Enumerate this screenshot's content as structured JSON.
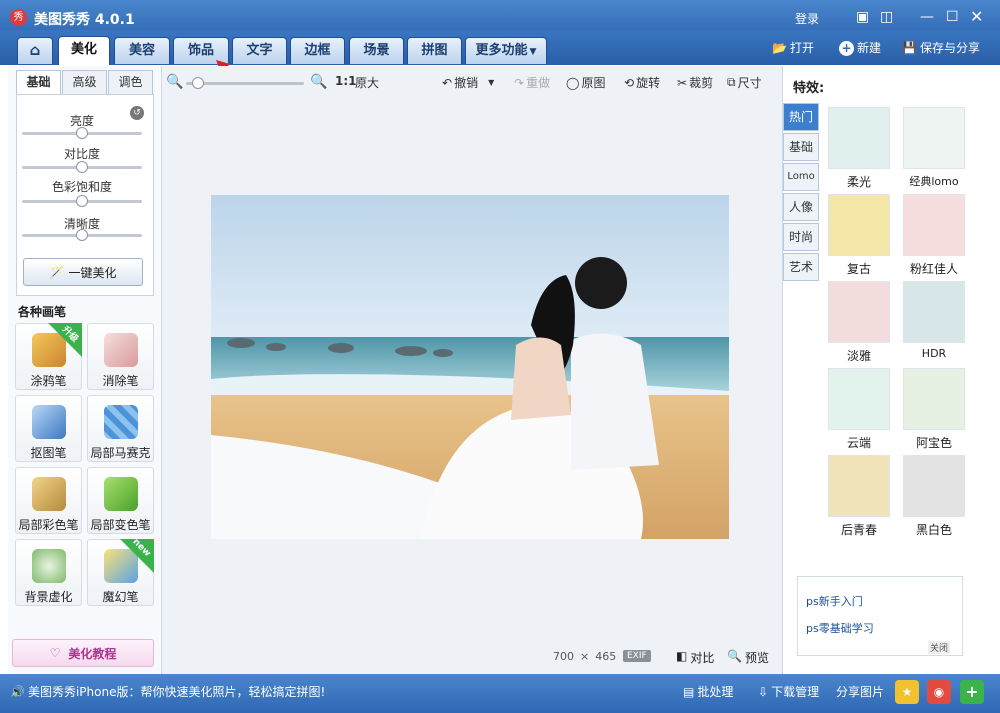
{
  "window": {
    "title": "美图秀秀 4.0.1",
    "login": "登录"
  },
  "tabs": [
    {
      "label": "美化",
      "active": true
    },
    {
      "label": "美容",
      "active": false
    },
    {
      "label": "饰品",
      "active": false
    },
    {
      "label": "文字",
      "active": false
    },
    {
      "label": "边框",
      "active": false
    },
    {
      "label": "场景",
      "active": false
    },
    {
      "label": "拼图",
      "active": false
    },
    {
      "label": "更多功能",
      "active": false
    }
  ],
  "header_actions": {
    "open": "打开",
    "new": "新建",
    "save_share": "保存与分享"
  },
  "left": {
    "subtabs": [
      "基础",
      "高级",
      "调色"
    ],
    "sliders": [
      {
        "label": "亮度",
        "value": 0.5
      },
      {
        "label": "对比度",
        "value": 0.5
      },
      {
        "label": "色彩饱和度",
        "value": 0.5
      },
      {
        "label": "清晰度",
        "value": 0.5
      }
    ],
    "one_click": "一键美化",
    "brushes_title": "各种画笔",
    "brushes": [
      {
        "label": "涂鸦笔",
        "badge": "升级"
      },
      {
        "label": "消除笔",
        "badge": ""
      },
      {
        "label": "抠图笔",
        "badge": ""
      },
      {
        "label": "局部马赛克",
        "badge": ""
      },
      {
        "label": "局部彩色笔",
        "badge": ""
      },
      {
        "label": "局部变色笔",
        "badge": ""
      },
      {
        "label": "背景虚化",
        "badge": ""
      },
      {
        "label": "魔幻笔",
        "badge": "new"
      }
    ],
    "tutorial": "美化教程"
  },
  "toolbar": {
    "zoom_value": 0.1,
    "actual_size": "1:1",
    "original_size": "原大",
    "undo": "撤销",
    "redo": "重做",
    "original": "原图",
    "rotate": "旋转",
    "crop": "裁剪",
    "resize": "尺寸"
  },
  "image_info": {
    "width": "700",
    "times": "×",
    "height": "465",
    "exif": "EXIF",
    "compare": "对比",
    "preview": "预览"
  },
  "right": {
    "title": "特效:",
    "vtabs": [
      "热门",
      "基础",
      "Lomo",
      "人像",
      "时尚",
      "艺术"
    ],
    "effects": [
      {
        "label": "柔光",
        "tint": "#dff0ee"
      },
      {
        "label": "经典lomo",
        "tint": "#eef4f1"
      },
      {
        "label": "复古",
        "tint": "#f4e7a8"
      },
      {
        "label": "粉红佳人",
        "tint": "#f7dede"
      },
      {
        "label": "淡雅",
        "tint": "#f2dcdc"
      },
      {
        "label": "HDR",
        "tint": "#d6e6e9"
      },
      {
        "label": "云端",
        "tint": "#e2f3ee"
      },
      {
        "label": "阿宝色",
        "tint": "#e7f1e3"
      },
      {
        "label": "后青春",
        "tint": "#f0e3b8"
      },
      {
        "label": "黑白色",
        "tint": "#e3e3e3"
      }
    ],
    "links": [
      "ps新手入门",
      "ps零基础学习"
    ],
    "close_ad": "关闭"
  },
  "status": {
    "promo": "美图秀秀iPhone版：帮你快速美化照片，轻松搞定拼图!",
    "batch": "批处理",
    "download": "下载管理",
    "share": "分享图片"
  },
  "colors": {
    "accent": "#2f68b4",
    "green": "#3bb34a"
  }
}
